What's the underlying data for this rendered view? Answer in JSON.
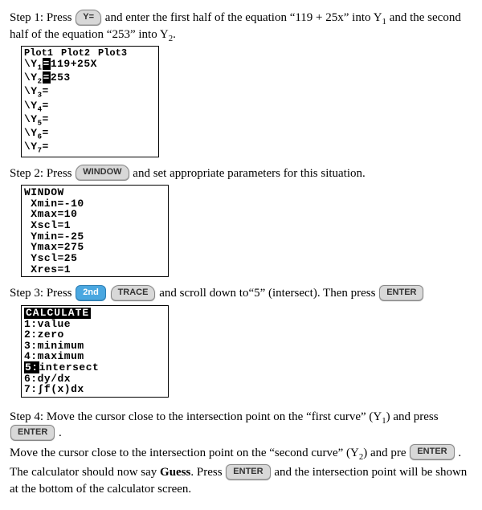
{
  "keys": {
    "yeq": "Y=",
    "window": "WINDOW",
    "second": "2nd",
    "trace": "TRACE",
    "enter": "ENTER"
  },
  "step1": {
    "lead": "Step 1: Press ",
    "mid": " and enter the first half of the equation “119 + 25x” into Y",
    "mid2": " and the second half of the equation “253” into Y",
    "end": ".",
    "sub1": "1",
    "sub2": "2",
    "screen": {
      "header": [
        "Plot1",
        "Plot2",
        "Plot3"
      ],
      "rows": [
        {
          "pre": "\\Y",
          "sub": "1",
          "sel": "=",
          "rest": "119+25X"
        },
        {
          "pre": "\\Y",
          "sub": "2",
          "sel": "=",
          "rest": "253"
        },
        {
          "pre": "\\Y",
          "sub": "3",
          "sel": "",
          "rest": "="
        },
        {
          "pre": "\\Y",
          "sub": "4",
          "sel": "",
          "rest": "="
        },
        {
          "pre": "\\Y",
          "sub": "5",
          "sel": "",
          "rest": "="
        },
        {
          "pre": "\\Y",
          "sub": "6",
          "sel": "",
          "rest": "="
        },
        {
          "pre": "\\Y",
          "sub": "7",
          "sel": "",
          "rest": "="
        }
      ]
    }
  },
  "step2": {
    "lead": "Step 2: Press ",
    "tail": " and set appropriate parameters for this situation.",
    "screen": {
      "title": "WINDOW",
      "rows": [
        " Xmin=-10",
        " Xmax=10",
        " Xscl=1",
        " Ymin=-25",
        " Ymax=275",
        " Yscl=25",
        " Xres=1"
      ]
    }
  },
  "step3": {
    "lead": "Step 3: Press ",
    "mid": " and scroll down to“5” (intersect). Then press ",
    "screen": {
      "title": "CALCULATE",
      "rows": [
        {
          "n": "1",
          "sel": false,
          "label": "value"
        },
        {
          "n": "2",
          "sel": false,
          "label": "zero"
        },
        {
          "n": "3",
          "sel": false,
          "label": "minimum"
        },
        {
          "n": "4",
          "sel": false,
          "label": "maximum"
        },
        {
          "n": "5",
          "sel": true,
          "label": "intersect"
        },
        {
          "n": "6",
          "sel": false,
          "label": "dy/dx"
        },
        {
          "n": "7",
          "sel": false,
          "label": "∫f(x)dx"
        }
      ]
    }
  },
  "step4": {
    "line1_a": "Step 4: Move the cursor close to the intersection point on the “first curve” (Y",
    "line1_sub": "1",
    "line1_b": ") and press ",
    "line1_c": " .",
    "line2_a": "Move the cursor close to the intersection point on the “second curve” (Y",
    "line2_sub": "2",
    "line2_b": ") and pre ",
    "line2_c": "    .",
    "line3_a": "The calculator should now say ",
    "guess": "Guess",
    "line3_b": ". Press ",
    "line3_c": " and the intersection point will be shown at the bottom of the calculator screen."
  }
}
